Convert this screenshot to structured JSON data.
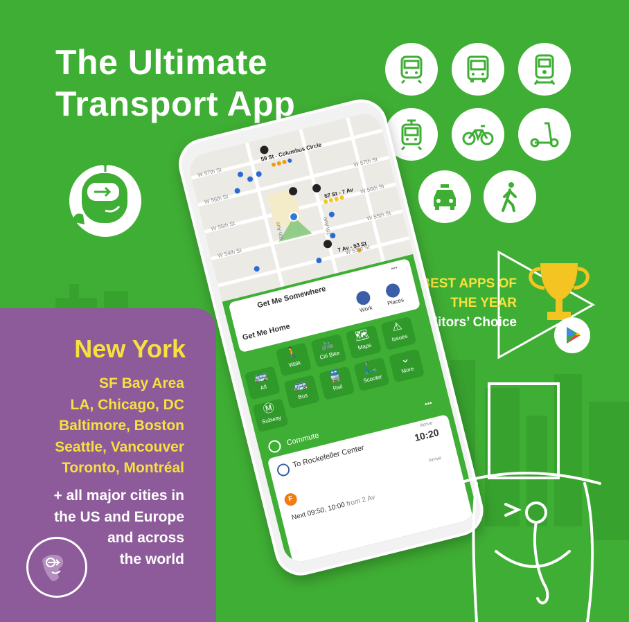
{
  "headline": {
    "line1": "The Ultimate",
    "line2": "Transport App"
  },
  "transport_modes": [
    {
      "icon": "subway-icon"
    },
    {
      "icon": "bus-icon"
    },
    {
      "icon": "train-icon"
    },
    {
      "icon": "tram-icon"
    },
    {
      "icon": "bike-icon"
    },
    {
      "icon": "scooter-icon"
    },
    {
      "icon": "taxi-icon"
    },
    {
      "icon": "walk-icon"
    }
  ],
  "award": {
    "line1": "BEST APPS OF",
    "line2": "THE YEAR",
    "line3": "+ Editors’ Choice"
  },
  "cities": {
    "main": "New York",
    "list": [
      "SF Bay Area",
      "LA, Chicago, DC",
      "Baltimore, Boston",
      "Seattle, Vancouver",
      "Toronto, Montréal"
    ],
    "more": [
      "+ all major cities in",
      "the US and Europe",
      "and across",
      "the world"
    ]
  },
  "map": {
    "streets": [
      "W 57th St",
      "W 56th St",
      "W 55th St",
      "W 54th St",
      "W 53rd St",
      "8th Ave",
      "7th Ave",
      "W 57th St",
      "W 56th St",
      "W 55th St"
    ],
    "stops": [
      "59 St - Columbus Circle",
      "57 St - 7 Av",
      "7 Av - 53 St"
    ]
  },
  "app": {
    "get_me_somewhere": "Get Me Somewhere",
    "get_me_home": "Get Me Home",
    "work": "Work",
    "places": "Places",
    "tiles": [
      {
        "label": "Walk",
        "glyph": "🚶"
      },
      {
        "label": "Citi Bike",
        "glyph": "🚲"
      },
      {
        "label": "Maps",
        "glyph": "🗺"
      },
      {
        "label": "Issues",
        "glyph": "⚠"
      },
      {
        "label": "All",
        "glyph": "🚌"
      },
      {
        "label": "Bus",
        "glyph": "🚌"
      },
      {
        "label": "Rail",
        "glyph": "🚆"
      },
      {
        "label": "Scooter",
        "glyph": "🛴"
      },
      {
        "label": "More",
        "glyph": "⌄"
      },
      {
        "label": "Subway",
        "glyph": "Ⓜ"
      }
    ],
    "commute": "Commute",
    "to_destination": "To Rockefeller Center",
    "arrive_label": "Arrive",
    "arrive_time": "10:20",
    "arrive_label2": "Arrive",
    "line_letter": "F",
    "next_times": "Next 09:50, 10:00",
    "next_from": "from 2 Av",
    "menu_dots": "•••"
  },
  "colors": {
    "brand_green": "#3fae34",
    "purple": "#8d5a9a",
    "yellow": "#f7e13e"
  }
}
